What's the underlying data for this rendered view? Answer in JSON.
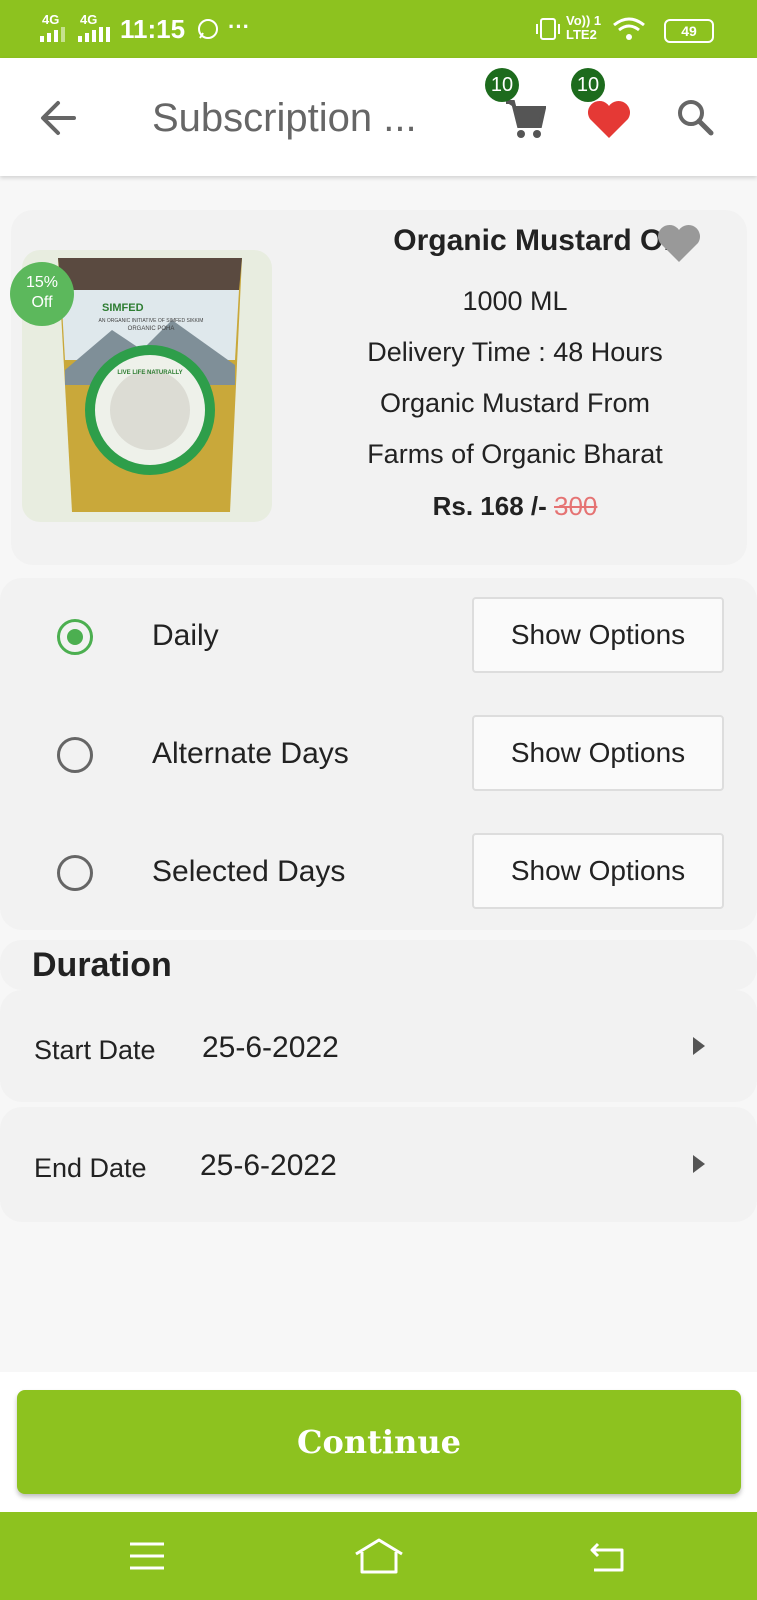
{
  "status_bar": {
    "time": "11:15",
    "network_1": "4G",
    "network_2": "4G",
    "lte": "Vo)) 1\nLTE2",
    "battery": "49",
    "more": "···"
  },
  "app_bar": {
    "title": "Subscription ...",
    "cart_count": "10",
    "wishlist_count": "10"
  },
  "product": {
    "discount_pct": "15%",
    "discount_label": "Off",
    "name": "Organic Mustard Oil",
    "quantity": "1000 ML",
    "delivery_time": "Delivery Time : 48 Hours",
    "description_1": "Organic Mustard From",
    "description_2": "Farms of Organic Bharat",
    "price": "Rs. 168 /-",
    "original_price": "300",
    "image_brand": "SIMFED",
    "image_tagline": "AN ORGANIC INITIATIVE OF SIMFED SIKKIM",
    "image_product": "ORGANIC POHA",
    "image_arc_text": "LIVE LIFE NATURALLY"
  },
  "frequency_options": [
    {
      "label": "Daily",
      "selected": true,
      "button": "Show Options"
    },
    {
      "label": "Alternate Days",
      "selected": false,
      "button": "Show Options"
    },
    {
      "label": "Selected Days",
      "selected": false,
      "button": "Show Options"
    }
  ],
  "duration": {
    "heading": "Duration",
    "start_label": "Start Date",
    "start_value": "25-6-2022",
    "end_label": "End Date",
    "end_value": "25-6-2022"
  },
  "continue_label": "Continue",
  "colors": {
    "brand_green": "#8dc21f",
    "badge_green": "#1d6b1d",
    "radio_green": "#4caf50",
    "heart_red": "#e53935",
    "strike_red": "#e57373"
  },
  "icons": [
    "back-arrow-icon",
    "cart-icon",
    "heart-icon",
    "search-icon",
    "favorite-outline-icon",
    "chevron-right-icon",
    "menu-icon",
    "home-icon",
    "back-nav-icon"
  ]
}
